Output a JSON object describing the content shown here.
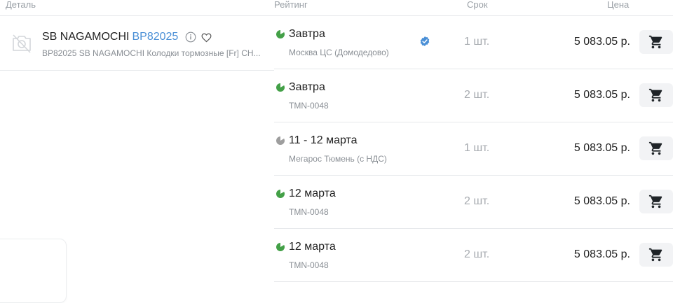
{
  "columns": {
    "detail": "Деталь",
    "rating": "Рейтинг",
    "term": "Срок",
    "price": "Цена"
  },
  "product": {
    "brand": "SB NAGAMOCHI",
    "number": "BP82025",
    "description": "BP82025 SB NAGAMOCHI Колодки тормозные [Fr] CH...",
    "photo_icon": "no-photo-icon",
    "accent_color": "#4a8fd6"
  },
  "offers": [
    {
      "delivery": "Завтра",
      "warehouse": "Москва ЦС (Домодедово)",
      "quantity": "1 шт.",
      "price": "5 083.05 р.",
      "rating_status": "green",
      "verified": true
    },
    {
      "delivery": "Завтра",
      "warehouse": "TMN-0048",
      "quantity": "2 шт.",
      "price": "5 083.05 р.",
      "rating_status": "green",
      "verified": false
    },
    {
      "delivery": "11 - 12 марта",
      "warehouse": "Мегарос Тюмень (с НДС)",
      "quantity": "1 шт.",
      "price": "5 083.05 р.",
      "rating_status": "gray",
      "verified": false
    },
    {
      "delivery": "12 марта",
      "warehouse": "TMN-0048",
      "quantity": "2 шт.",
      "price": "5 083.05 р.",
      "rating_status": "green",
      "verified": false
    },
    {
      "delivery": "12 марта",
      "warehouse": "TMN-0048",
      "quantity": "2 шт.",
      "price": "5 083.05 р.",
      "rating_status": "green",
      "verified": false
    }
  ],
  "colors": {
    "rating_green": "#43a047",
    "rating_gray": "#9e9e9e",
    "verified": "#4a8fd6"
  }
}
